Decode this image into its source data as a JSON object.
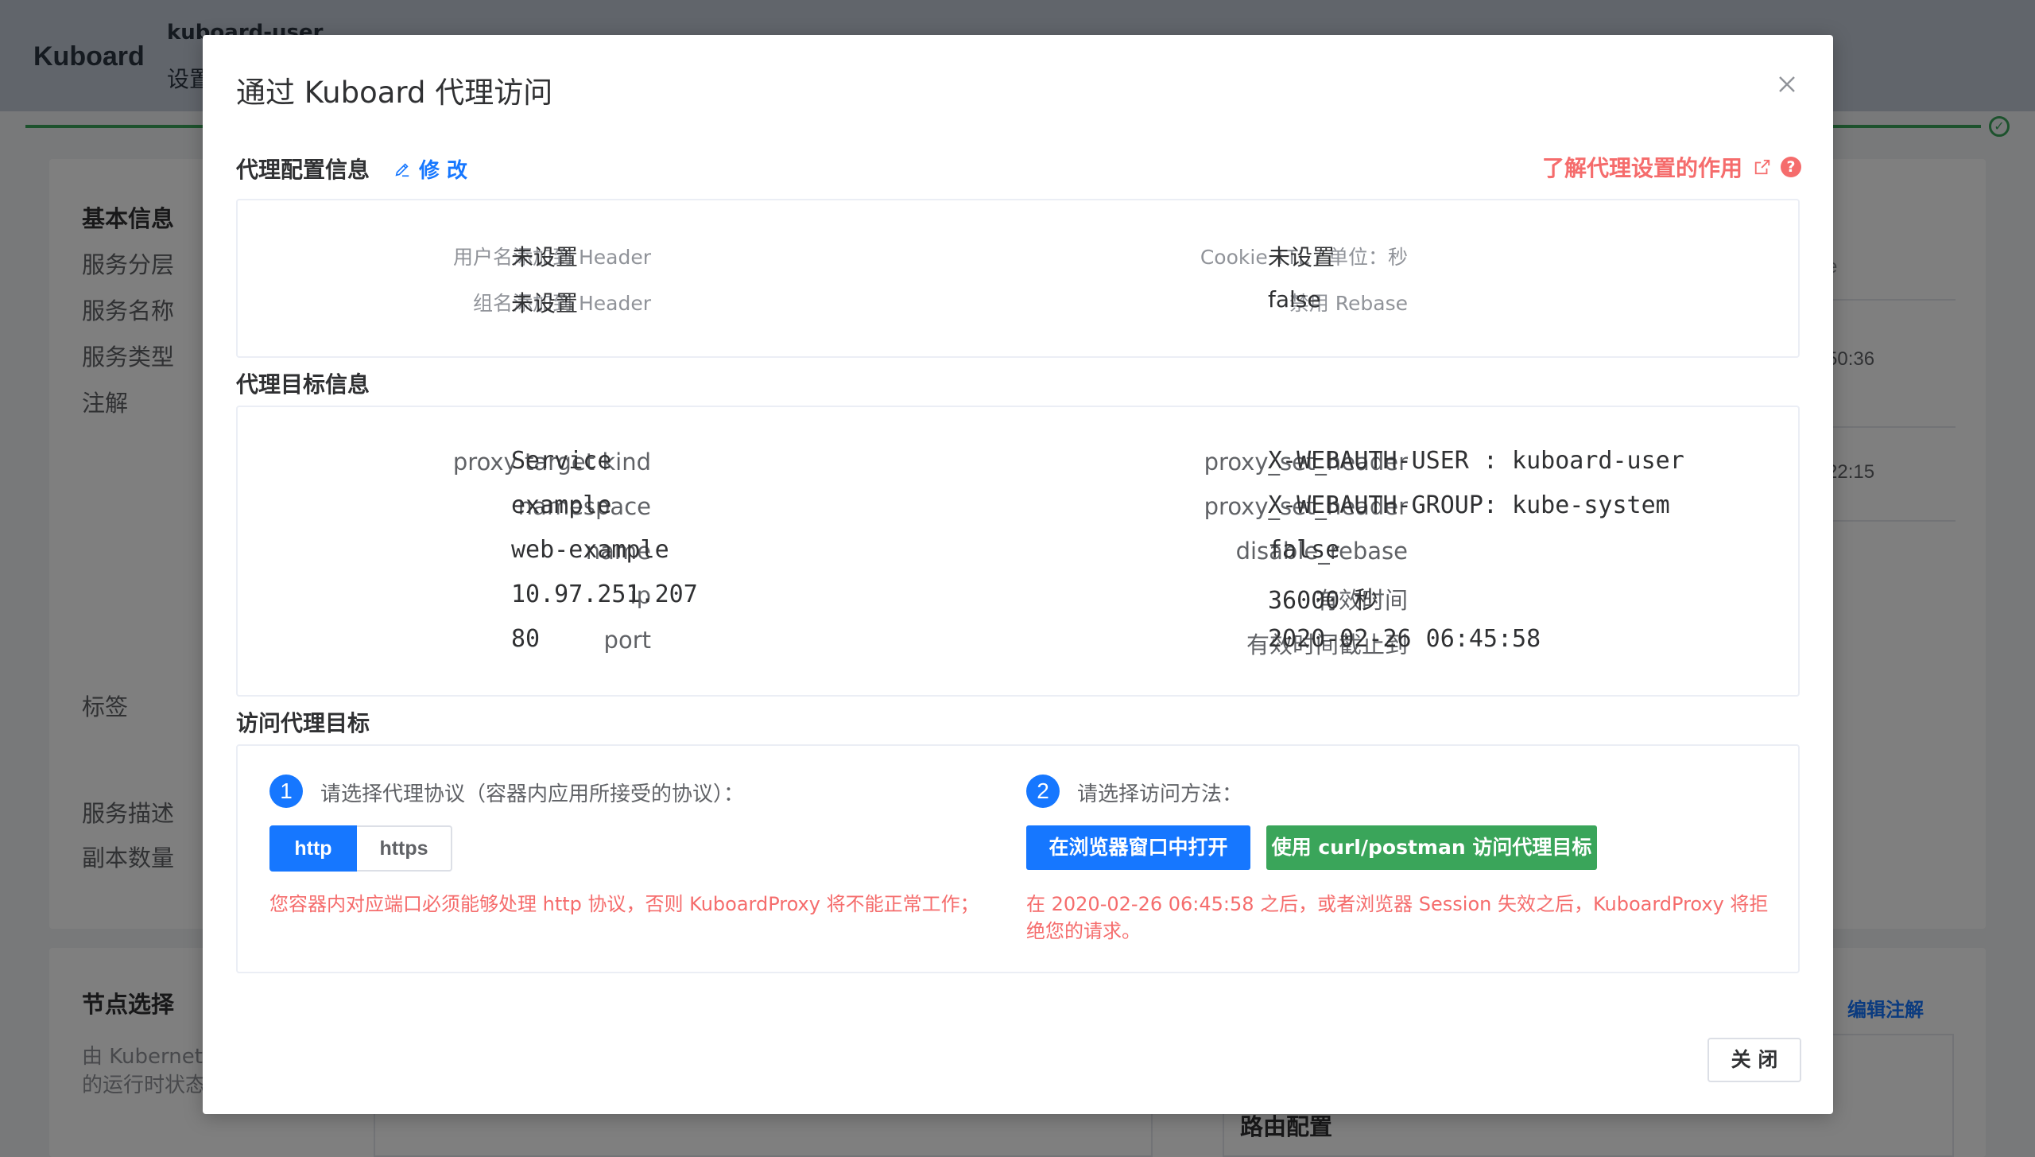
{
  "app": {
    "brand": "Kuboard",
    "user": "kuboard-user",
    "settings": "设置"
  },
  "background": {
    "left_labels": [
      "基本信息",
      "服务分层",
      "服务名称",
      "服务类型",
      "注解",
      "标签",
      "服务描述",
      "副本数量"
    ],
    "node_select_title": "节点选择",
    "node_desc_1": "由 Kubernete",
    "node_desc_2": "的运行时状态",
    "right_fragment": "e",
    "time_1": "50:36",
    "time_2": "22:15",
    "edit_annotation": "编辑注解",
    "route_config": "路由配置"
  },
  "dialog": {
    "title": "通过 Kuboard 代理访问",
    "proxy_config": {
      "title": "代理配置信息",
      "edit_label": "修 改",
      "learn_link": "了解代理设置的作用",
      "help_glyph": "?",
      "rows_left": [
        {
          "key": "用户名添加到 Header",
          "value": "未设置"
        },
        {
          "key": "组名添加到 Header",
          "value": "未设置"
        }
      ],
      "rows_right": [
        {
          "key": "Cookie TTL / 单位：秒",
          "value": "未设置"
        },
        {
          "key": "禁用 Rebase",
          "value": "false"
        }
      ]
    },
    "proxy_target": {
      "title": "代理目标信息",
      "rows_left": [
        {
          "key": "proxy target kind",
          "value": "Service"
        },
        {
          "key": "namespace",
          "value": "example"
        },
        {
          "key": "name",
          "value": "web-example"
        },
        {
          "key": "ip",
          "value": "10.97.251.207"
        },
        {
          "key": "port",
          "value": "80"
        }
      ],
      "rows_right": [
        {
          "key": "proxy_set_header",
          "value": "X-WEBAUTH-USER : kuboard-user"
        },
        {
          "key": "proxy_set_header",
          "value": "X-WEBAUTH-GROUP: kube-system"
        },
        {
          "key": "disable_rebase",
          "value": "false"
        },
        {
          "key": "有效时间",
          "value": "36000 秒"
        },
        {
          "key": "有效时间截止到",
          "value": "2020-02-26 06:45:58"
        }
      ]
    },
    "access": {
      "title": "访问代理目标",
      "step1": {
        "num": "1",
        "text": "请选择代理协议（容器内应用所接受的协议）："
      },
      "step2": {
        "num": "2",
        "text": "请选择访问方法："
      },
      "protocols": [
        "http",
        "https"
      ],
      "selected_protocol": "http",
      "open_browser": "在浏览器窗口中打开",
      "use_curl": "使用 curl/postman 访问代理目标",
      "warn_left": "您容器内对应端口必须能够处理 http 协议，否则 KuboardProxy 将不能正常工作；",
      "warn_right_1": "在 2020-02-26 06:45:58 之后，或者浏览器 Session 失效之后，KuboardProxy 将拒",
      "warn_right_2": "绝您的请求。"
    },
    "close_label": "关 闭"
  },
  "colors": {
    "primary": "#1677ff",
    "success": "#3aa55a",
    "danger": "#f56c6c"
  }
}
